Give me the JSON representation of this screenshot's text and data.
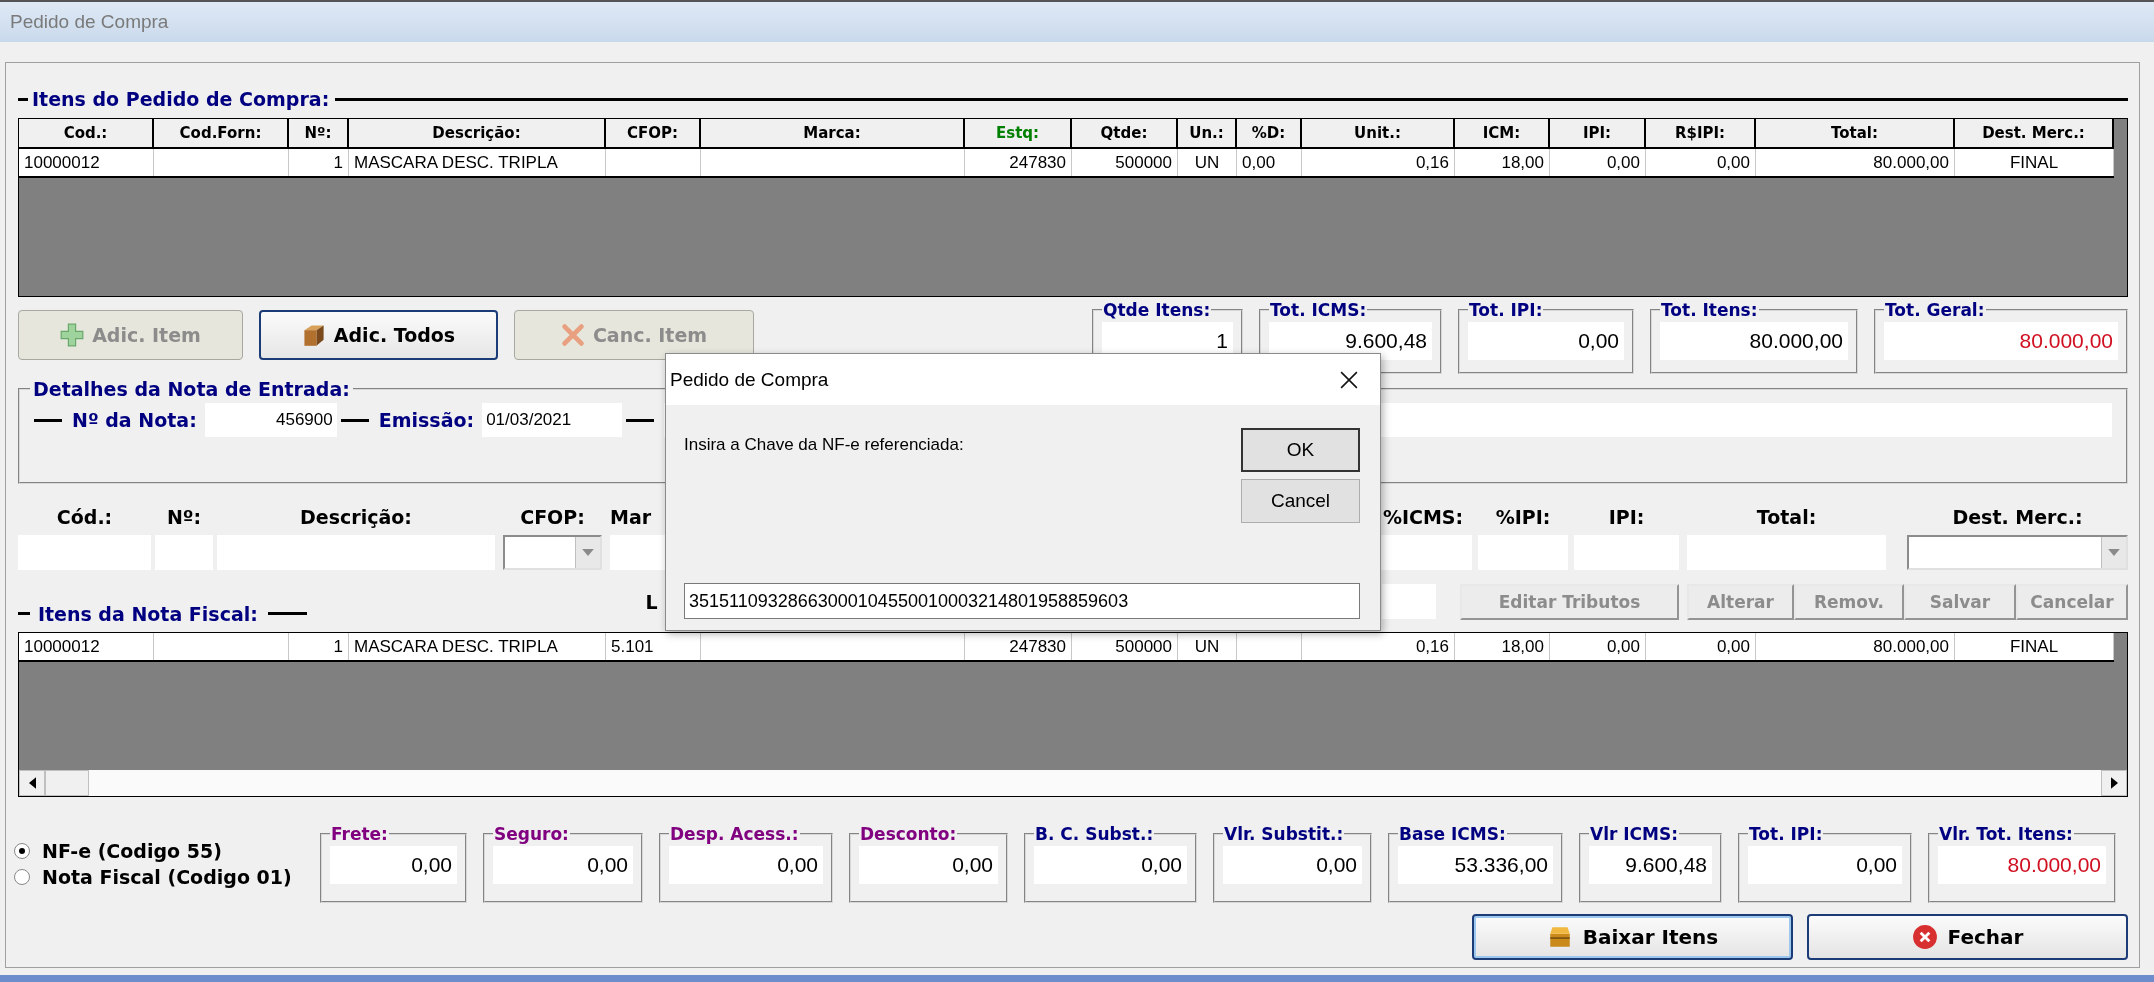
{
  "window": {
    "title": "Pedido de Compra"
  },
  "order_items": {
    "title": "Itens do Pedido de Compra:",
    "columns": [
      {
        "label": "Cod.:",
        "color": "#000000"
      },
      {
        "label": "Cod.Forn:",
        "color": "#000000"
      },
      {
        "label": "Nº:",
        "color": "#000000"
      },
      {
        "label": "Descrição:",
        "color": "#000000"
      },
      {
        "label": "CFOP:",
        "color": "#000000"
      },
      {
        "label": "Marca:",
        "color": "#000000"
      },
      {
        "label": "Estq:",
        "color": "#008000"
      },
      {
        "label": "Qtde:",
        "color": "#000000"
      },
      {
        "label": "Un.:",
        "color": "#000000"
      },
      {
        "label": "%D:",
        "color": "#000000"
      },
      {
        "label": "Unit.:",
        "color": "#000000"
      },
      {
        "label": "ICM:",
        "color": "#000000"
      },
      {
        "label": "IPI:",
        "color": "#000000"
      },
      {
        "label": "R$IPI:",
        "color": "#000000"
      },
      {
        "label": "Total:",
        "color": "#000000"
      },
      {
        "label": "Dest. Merc.:",
        "color": "#000000"
      }
    ],
    "rows": [
      [
        "10000012",
        null,
        "1",
        "MASCARA DESC. TRIPLA",
        null,
        null,
        "247830",
        "500000",
        "UN",
        "0,00",
        "0,16",
        "18,00",
        "0,00",
        "0,00",
        "80.000,00",
        "FINAL"
      ]
    ]
  },
  "item_buttons": [
    {
      "label": "Adic. Item",
      "disabled": true
    },
    {
      "label": "Adic. Todos",
      "disabled": false
    },
    {
      "label": "Canc. Item",
      "disabled": true
    }
  ],
  "totals": [
    {
      "label": "Qtde Itens:",
      "value": "1",
      "highlight": false
    },
    {
      "label": "Tot. ICMS:",
      "value": "9.600,48",
      "highlight": false
    },
    {
      "label": "Tot. IPI:",
      "value": "0,00",
      "highlight": false
    },
    {
      "label": "Tot. Itens:",
      "value": "80.000,00",
      "highlight": false
    },
    {
      "label": "Tot. Geral:",
      "value": "80.000,00",
      "highlight": true
    }
  ],
  "entry_details": {
    "title": "Detalhes da Nota de Entrada:",
    "fields": [
      {
        "label": "Nº da Nota:",
        "value": "456900"
      },
      {
        "label": "Emissão:",
        "value": "01/03/2021"
      }
    ]
  },
  "item_form": {
    "fields": [
      {
        "label": "Cód.:",
        "kind": "text"
      },
      {
        "label": "Nº:",
        "kind": "text"
      },
      {
        "label": "Descrição:",
        "kind": "text"
      },
      {
        "label": "CFOP:",
        "kind": "combo"
      },
      {
        "label": "Mar",
        "kind": "text"
      },
      {
        "label": "%ICMS:",
        "kind": "text"
      },
      {
        "label": "%IPI:",
        "kind": "text"
      },
      {
        "label": "IPI:",
        "kind": "text"
      },
      {
        "label": "Total:",
        "kind": "text"
      },
      {
        "label": "Dest. Merc.:",
        "kind": "combo"
      }
    ],
    "extra_label": "L",
    "buttons": [
      {
        "label": "Editar Tributos",
        "disabled": true
      },
      {
        "label": "Alterar",
        "disabled": true
      },
      {
        "label": "Remov.",
        "disabled": true
      },
      {
        "label": "Salvar",
        "disabled": true
      },
      {
        "label": "Cancelar",
        "disabled": true
      }
    ]
  },
  "invoice_items": {
    "title": "Itens da Nota Fiscal:",
    "rows": [
      [
        "10000012",
        null,
        "1",
        "MASCARA DESC. TRIPLA",
        "5.101",
        null,
        "247830",
        "500000",
        "UN",
        null,
        "0,16",
        "18,00",
        "0,00",
        "0,00",
        "80.000,00",
        "FINAL"
      ]
    ]
  },
  "doc_type": [
    {
      "label": "NF-e (Codigo 55)",
      "selected": true
    },
    {
      "label": "Nota Fiscal (Codigo 01)",
      "selected": false
    }
  ],
  "summary": [
    {
      "label": "Frete:",
      "value": "0,00",
      "color": "#800080",
      "highlight": false
    },
    {
      "label": "Seguro:",
      "value": "0,00",
      "color": "#800080",
      "highlight": false
    },
    {
      "label": "Desp. Acess.:",
      "value": "0,00",
      "color": "#800080",
      "highlight": false
    },
    {
      "label": "Desconto:",
      "value": "0,00",
      "color": "#800080",
      "highlight": false
    },
    {
      "label": "B. C. Subst.:",
      "value": "0,00",
      "color": "#000080",
      "highlight": false
    },
    {
      "label": "Vlr. Substit.:",
      "value": "0,00",
      "color": "#000080",
      "highlight": false
    },
    {
      "label": "Base ICMS:",
      "value": "53.336,00",
      "color": "#000080",
      "highlight": false
    },
    {
      "label": "Vlr ICMS:",
      "value": "9.600,48",
      "color": "#000080",
      "highlight": false
    },
    {
      "label": "Tot. IPI:",
      "value": "0,00",
      "color": "#000080",
      "highlight": false
    },
    {
      "label": "Vlr. Tot. Itens:",
      "value": "80.000,00",
      "color": "#000080",
      "highlight": true
    }
  ],
  "actions": [
    {
      "label": "Baixar Itens"
    },
    {
      "label": "Fechar"
    }
  ],
  "dialog": {
    "title": "Pedido de Compra",
    "prompt": "Insira a Chave da NF-e referenciada:",
    "value": "35151109328663000104550010003214801958859603",
    "buttons": [
      "OK",
      "Cancel"
    ]
  }
}
